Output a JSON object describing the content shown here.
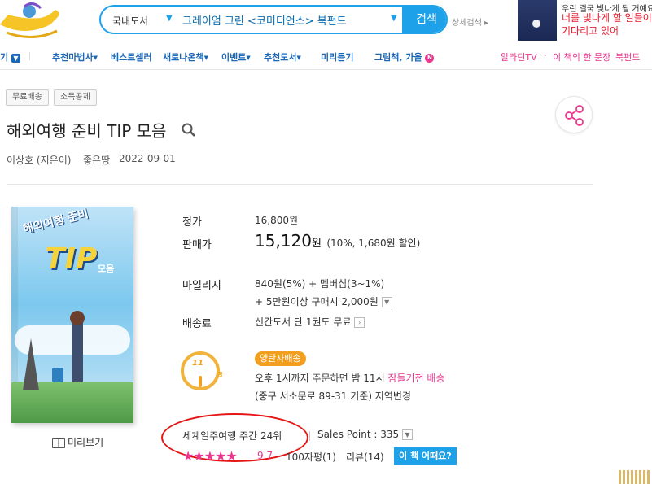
{
  "search": {
    "category": "국내도서",
    "query": "그레이엄 그린 <코미디언스> 북펀드",
    "button_label": "검색",
    "advanced_label": "상세검색"
  },
  "ad": {
    "line1": "우린 결국 빛나게 될 거예요",
    "line2": "너를 빛나게 할 일들이",
    "line3": "기다리고 있어"
  },
  "nav": {
    "first": "기",
    "items": [
      "추천마법사",
      "베스트셀러",
      "새로나온책",
      "이벤트",
      "추천도서",
      "미리듣기",
      "그림책, 가을"
    ],
    "new_badge": "N",
    "right_items": [
      "알라딘TV",
      "이 책의 한 문장",
      "북펀드"
    ]
  },
  "badges": [
    "무료배송",
    "소득공제"
  ],
  "book": {
    "title": "해외여행 준비 TIP 모음",
    "author": "이상호 (지은이)",
    "publisher": "좋은땅",
    "pubdate": "2022-09-01",
    "cover_title": "해외여행 준비",
    "cover_tip": "TIP",
    "cover_sub": "모음",
    "preview_label": "미리보기"
  },
  "price": {
    "list_label": "정가",
    "list_value": "16,800원",
    "sale_label": "판매가",
    "sale_value": "15,120",
    "sale_unit": "원",
    "sale_discount": "(10%, 1,680원 할인)",
    "mileage_label": "마일리지",
    "mileage_line1": "840원(5%) + 멤버십(3~1%)",
    "mileage_line2": "+ 5만원이상 구매시 2,000원",
    "shipping_label": "배송료",
    "shipping_value": "신간도서 단 1권도 무료"
  },
  "delivery": {
    "badge": "양탄자배송",
    "clock_11": "11",
    "clock_3": "3",
    "line1_prefix": "오후 1시까지 주문하면 밤 11시",
    "line1_highlight": "잠들기전 배송",
    "line2": "(중구 서소문로 89-31 기준) 지역변경"
  },
  "rank": {
    "text": "세계일주여행 주간 24위",
    "sales_point": "Sales Point : 335"
  },
  "rating": {
    "stars": "★★★★★",
    "score": "9.7",
    "review_count": "100자평(1)",
    "reviews": "리뷰(14)",
    "ask_button": "이 책 어때요?"
  },
  "colors": {
    "accent": "#1da1e8",
    "nav_blue": "#1b67b5",
    "pink": "#e9368f",
    "orange": "#f29f1f",
    "annotation_red": "#e61515"
  }
}
